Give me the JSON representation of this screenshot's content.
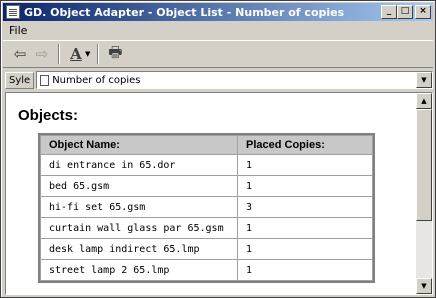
{
  "window": {
    "title": "GD. Object Adapter - Object List - Number of copies"
  },
  "title_buttons": {
    "minimize": "_",
    "maximize": "□",
    "close": "×"
  },
  "menu": {
    "items": [
      {
        "label": "File"
      }
    ]
  },
  "toolbar": {
    "back_icon": "⇦",
    "forward_icon": "⇨",
    "font_icon": "A",
    "dropdown_arrow": "▼",
    "print_icon": "🖶"
  },
  "style": {
    "label": "Syle",
    "value": "Number of copies",
    "dropdown_arrow": "▼"
  },
  "content": {
    "heading": "Objects:",
    "table": {
      "headers": [
        "Object Name:",
        "Placed Copies:"
      ],
      "rows": [
        [
          "di entrance in 65.dor",
          "1"
        ],
        [
          "bed 65.gsm",
          "1"
        ],
        [
          "hi-fi set 65.gsm",
          "3"
        ],
        [
          "curtain wall glass par 65.gsm",
          "1"
        ],
        [
          "desk lamp indirect 65.lmp",
          "1"
        ],
        [
          "street lamp 2 65.lmp",
          "1"
        ]
      ]
    }
  },
  "scrollbar": {
    "up_arrow": "▲",
    "down_arrow": "▼"
  }
}
